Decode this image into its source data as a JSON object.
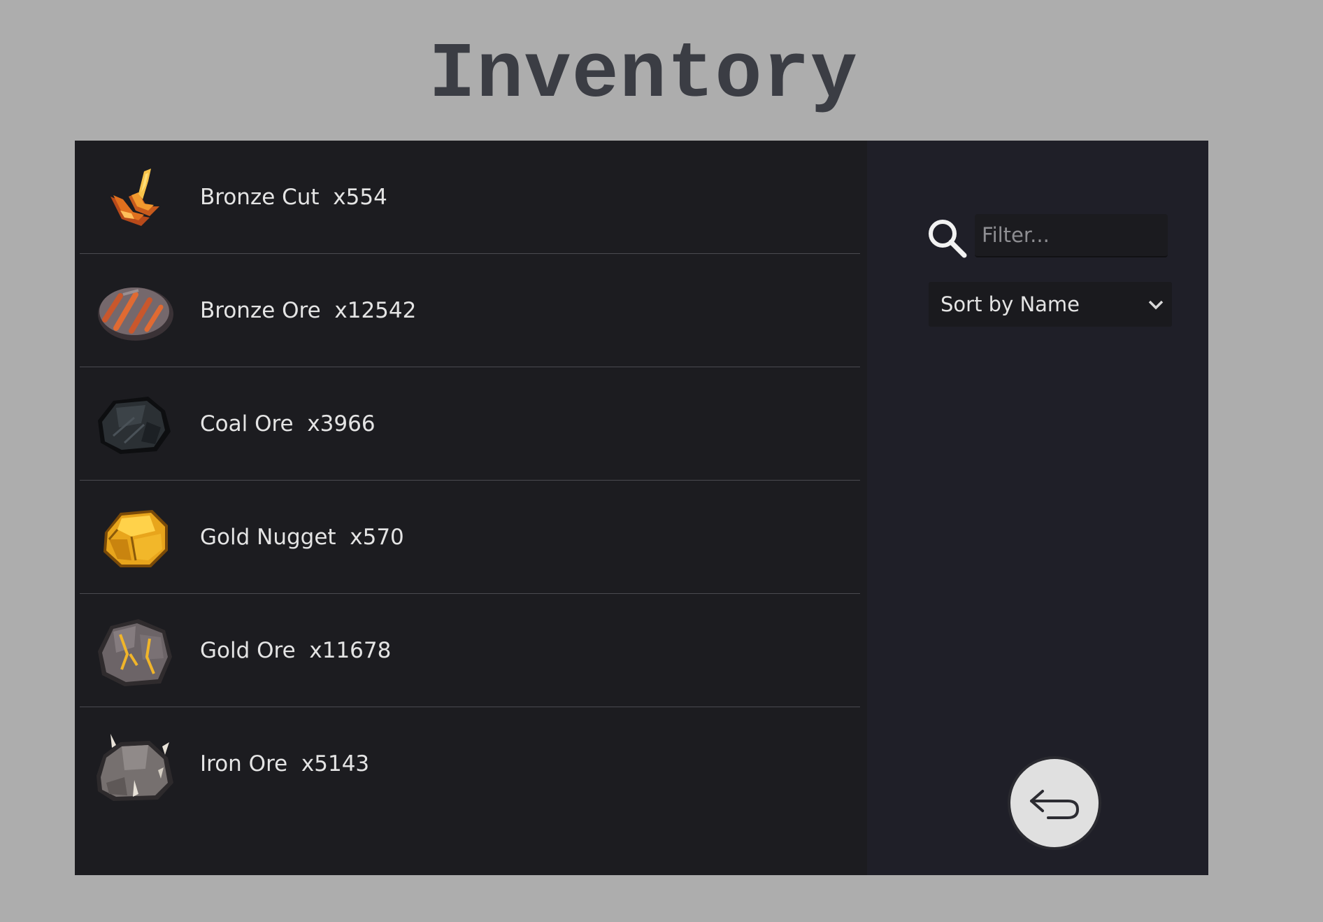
{
  "title": "Inventory",
  "items": [
    {
      "name": "Bronze Cut",
      "count": "x554",
      "label": "Bronze Cut  x554",
      "icon": "bronze-cut-icon"
    },
    {
      "name": "Bronze Ore",
      "count": "x12542",
      "label": "Bronze Ore  x12542",
      "icon": "bronze-ore-icon"
    },
    {
      "name": "Coal Ore",
      "count": "x3966",
      "label": "Coal Ore  x3966",
      "icon": "coal-ore-icon"
    },
    {
      "name": "Gold Nugget",
      "count": "x570",
      "label": "Gold Nugget  x570",
      "icon": "gold-nugget-icon"
    },
    {
      "name": "Gold Ore",
      "count": "x11678",
      "label": "Gold Ore  x11678",
      "icon": "gold-ore-icon"
    },
    {
      "name": "Iron Ore",
      "count": "x5143",
      "label": "Iron Ore  x5143",
      "icon": "iron-ore-icon"
    }
  ],
  "filter": {
    "placeholder": "Filter...",
    "value": "",
    "icon": "search-icon"
  },
  "sort": {
    "selected": "Sort by Name",
    "icon": "chevron-down-icon"
  },
  "back_button": {
    "icon": "back-arrow-icon"
  },
  "colors": {
    "background": "#adadad",
    "title": "#3b3d44",
    "list_panel": "#1c1c20",
    "side_panel": "#1f1f28",
    "text": "#e4e4e4",
    "divider": "#4a4a50"
  }
}
